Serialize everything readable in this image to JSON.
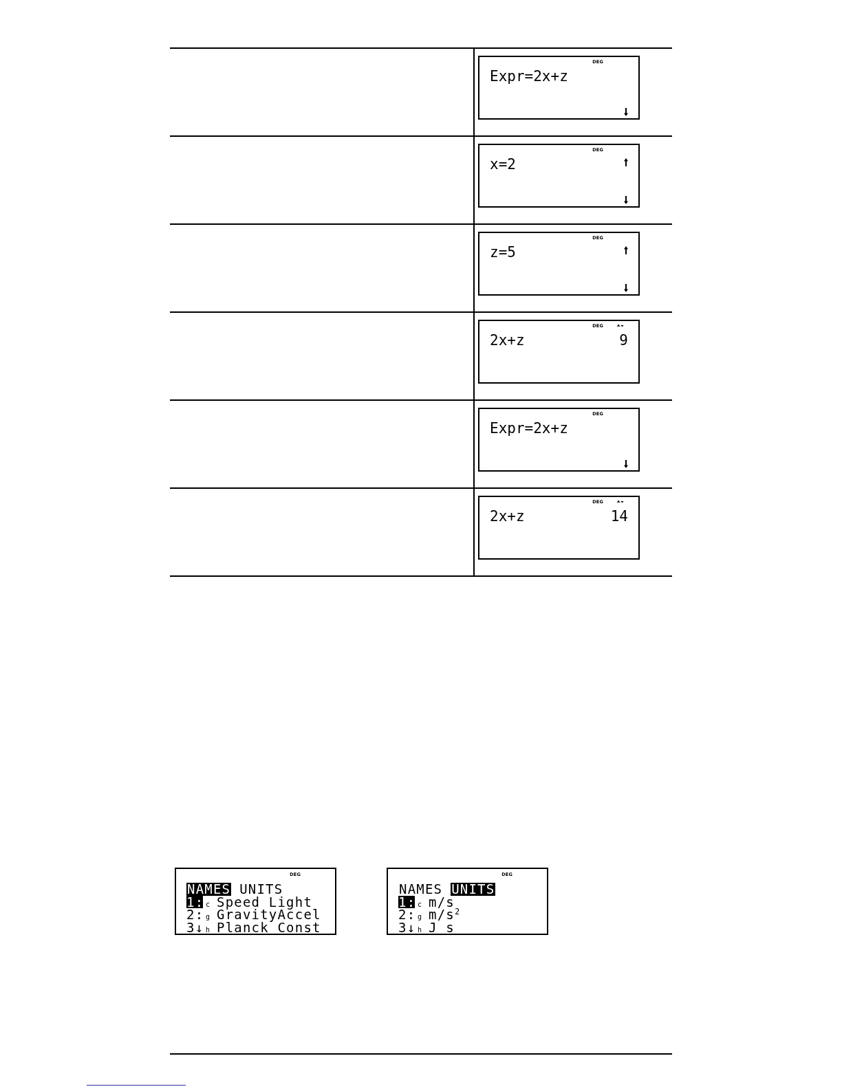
{
  "table": {
    "rows": [
      {
        "screen": {
          "mode": "DEG",
          "expression": "Expr=2x+z",
          "scroll_up": false,
          "scroll_down": true,
          "history_indicator": false
        }
      },
      {
        "screen": {
          "mode": "DEG",
          "expression": "x=2",
          "scroll_up": true,
          "scroll_down": true,
          "history_indicator": false
        }
      },
      {
        "screen": {
          "mode": "DEG",
          "expression": "z=5",
          "scroll_up": true,
          "scroll_down": true,
          "history_indicator": false
        }
      },
      {
        "screen": {
          "mode": "DEG",
          "expression": "2x+z",
          "result": "9",
          "scroll_up": false,
          "scroll_down": false,
          "history_indicator": true
        }
      },
      {
        "screen": {
          "mode": "DEG",
          "expression": "Expr=2x+z",
          "scroll_up": false,
          "scroll_down": true,
          "history_indicator": false
        }
      },
      {
        "screen": {
          "mode": "DEG",
          "expression": "2x+z",
          "result": "14",
          "scroll_up": false,
          "scroll_down": false,
          "history_indicator": true
        }
      }
    ]
  },
  "menu_screens": [
    {
      "mode": "DEG",
      "tabs": [
        {
          "label": "NAMES",
          "selected": true
        },
        {
          "label": "UNITS",
          "selected": false
        }
      ],
      "items": [
        {
          "number": "1:",
          "symbol": "c",
          "label": "Speed Light",
          "selected": true
        },
        {
          "number": "2:",
          "symbol": "g",
          "label": "GravityAccel",
          "selected": false
        },
        {
          "number": "3↓",
          "symbol": "h",
          "label": "Planck Const",
          "selected": false
        }
      ]
    },
    {
      "mode": "DEG",
      "tabs": [
        {
          "label": "NAMES",
          "selected": false
        },
        {
          "label": "UNITS",
          "selected": true
        }
      ],
      "items": [
        {
          "number": "1:",
          "symbol": "c",
          "label": "m/s",
          "selected": true
        },
        {
          "number": "2:",
          "symbol": "g",
          "label": "m/s$^{2}$",
          "selected": false
        },
        {
          "number": "3↓",
          "symbol": "h",
          "label": "J s",
          "selected": false
        }
      ]
    }
  ]
}
